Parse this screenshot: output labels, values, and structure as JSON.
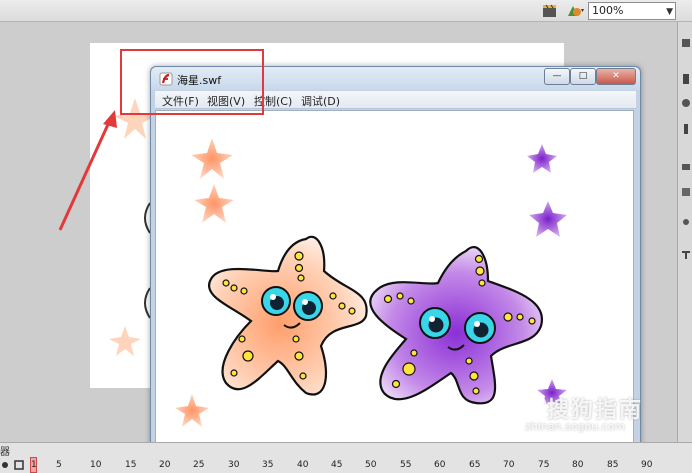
{
  "toolbar": {
    "zoom_value": "100%"
  },
  "swf_window": {
    "title": "海星.swf",
    "menu": [
      "文件(F)",
      "视图(V)",
      "控制(C)",
      "调试(D)"
    ],
    "min_glyph": "—",
    "max_glyph": "□",
    "close_glyph": "✕"
  },
  "timeline": {
    "label": "器",
    "ticks": [
      "1",
      "5",
      "10",
      "15",
      "20",
      "25",
      "30",
      "35",
      "40",
      "45",
      "50",
      "55",
      "60",
      "65",
      "70",
      "75",
      "80",
      "85",
      "90"
    ]
  },
  "watermark": {
    "text": "搜狗指南",
    "url": "zhinan.sogou.com"
  },
  "colors": {
    "highlight": "#e23a3a",
    "starfish_orange": "#ffb48a",
    "starfish_purple": "#a24ed6",
    "small_star_orange": "#ffae86",
    "small_star_purple": "#8b2fd6"
  },
  "icons": {
    "toolbar_a": "clapperboard-icon",
    "toolbar_b": "symbol-edit-icon",
    "app": "flash-player-icon"
  }
}
